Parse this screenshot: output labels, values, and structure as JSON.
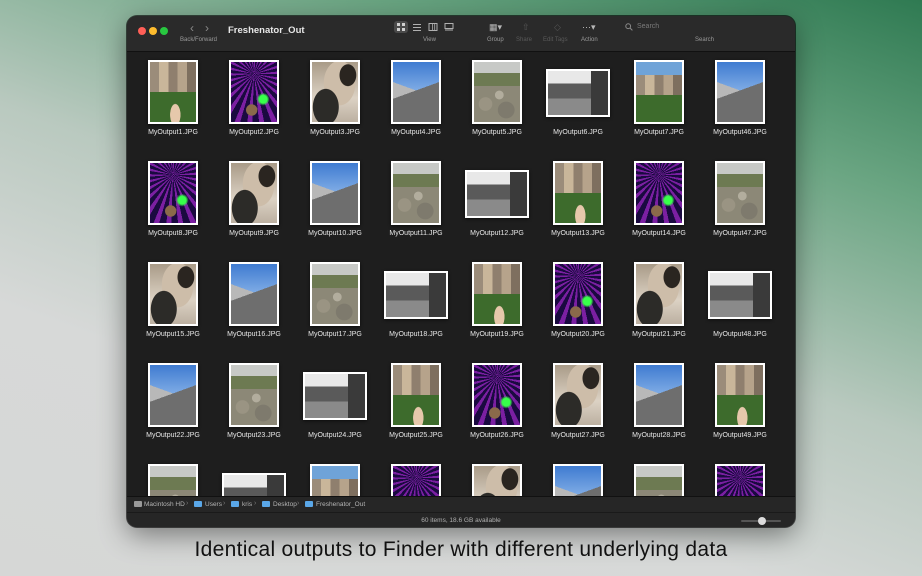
{
  "toolbar": {
    "title": "Freshenator_Out",
    "back_forward_label": "Back/Forward",
    "view_label": "View",
    "group_label": "Group",
    "share_label": "Share",
    "edit_tags_label": "Edit Tags",
    "action_label": "Action",
    "search_label": "Search",
    "search_placeholder": "Search"
  },
  "files": [
    {
      "name": "MyOutput1.JPG",
      "image": "city",
      "orientation": "portrait"
    },
    {
      "name": "MyOutput2.JPG",
      "image": "concert",
      "orientation": "portrait"
    },
    {
      "name": "MyOutput3.JPG",
      "image": "robot",
      "orientation": "portrait"
    },
    {
      "name": "MyOutput4.JPG",
      "image": "building",
      "orientation": "portrait"
    },
    {
      "name": "MyOutput5.JPG",
      "image": "rocks",
      "orientation": "portrait"
    },
    {
      "name": "MyOutput6.JPG",
      "image": "office",
      "orientation": "landscape"
    },
    {
      "name": "MyOutput7.JPG",
      "image": "city-sky",
      "orientation": "portrait"
    },
    {
      "name": "MyOutput46.JPG",
      "image": "building",
      "orientation": "portrait"
    },
    {
      "name": "MyOutput8.JPG",
      "image": "concert",
      "orientation": "portrait"
    },
    {
      "name": "MyOutput9.JPG",
      "image": "robot",
      "orientation": "portrait"
    },
    {
      "name": "MyOutput10.JPG",
      "image": "building",
      "orientation": "portrait"
    },
    {
      "name": "MyOutput11.JPG",
      "image": "rocks",
      "orientation": "portrait"
    },
    {
      "name": "MyOutput12.JPG",
      "image": "office",
      "orientation": "landscape"
    },
    {
      "name": "MyOutput13.JPG",
      "image": "city",
      "orientation": "portrait"
    },
    {
      "name": "MyOutput14.JPG",
      "image": "concert",
      "orientation": "portrait"
    },
    {
      "name": "MyOutput47.JPG",
      "image": "rocks",
      "orientation": "portrait"
    },
    {
      "name": "MyOutput15.JPG",
      "image": "robot",
      "orientation": "portrait"
    },
    {
      "name": "MyOutput16.JPG",
      "image": "building",
      "orientation": "portrait"
    },
    {
      "name": "MyOutput17.JPG",
      "image": "rocks",
      "orientation": "portrait"
    },
    {
      "name": "MyOutput18.JPG",
      "image": "office",
      "orientation": "landscape"
    },
    {
      "name": "MyOutput19.JPG",
      "image": "city",
      "orientation": "portrait"
    },
    {
      "name": "MyOutput20.JPG",
      "image": "concert",
      "orientation": "portrait"
    },
    {
      "name": "MyOutput21.JPG",
      "image": "robot",
      "orientation": "portrait"
    },
    {
      "name": "MyOutput48.JPG",
      "image": "office",
      "orientation": "landscape"
    },
    {
      "name": "MyOutput22.JPG",
      "image": "building",
      "orientation": "portrait"
    },
    {
      "name": "MyOutput23.JPG",
      "image": "rocks",
      "orientation": "portrait"
    },
    {
      "name": "MyOutput24.JPG",
      "image": "office",
      "orientation": "landscape"
    },
    {
      "name": "MyOutput25.JPG",
      "image": "city",
      "orientation": "portrait"
    },
    {
      "name": "MyOutput26.JPG",
      "image": "concert",
      "orientation": "portrait"
    },
    {
      "name": "MyOutput27.JPG",
      "image": "robot",
      "orientation": "portrait"
    },
    {
      "name": "MyOutput28.JPG",
      "image": "building",
      "orientation": "portrait"
    },
    {
      "name": "MyOutput49.JPG",
      "image": "city",
      "orientation": "portrait"
    },
    {
      "name": "",
      "image": "rocks",
      "orientation": "portrait"
    },
    {
      "name": "",
      "image": "office",
      "orientation": "landscape"
    },
    {
      "name": "",
      "image": "city-sky",
      "orientation": "portrait"
    },
    {
      "name": "",
      "image": "concert",
      "orientation": "portrait"
    },
    {
      "name": "",
      "image": "robot",
      "orientation": "portrait"
    },
    {
      "name": "",
      "image": "building",
      "orientation": "portrait"
    },
    {
      "name": "",
      "image": "rocks",
      "orientation": "portrait"
    },
    {
      "name": "",
      "image": "concert",
      "orientation": "portrait"
    }
  ],
  "path_bar": [
    "Macintosh HD",
    "Users",
    "kris",
    "Desktop",
    "Freshenator_Out"
  ],
  "status": {
    "text": "60 items, 18.6 GB available"
  },
  "caption": "Identical outputs to Finder with different underlying data",
  "colors": {
    "window_bg": "#1e1e1e",
    "folder_blue": "#5aa7e8",
    "close": "#ff5f57",
    "minimize": "#febc2e",
    "maximize": "#28c840"
  }
}
